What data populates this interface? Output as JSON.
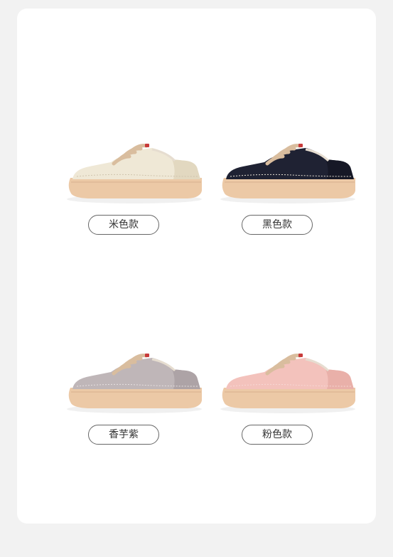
{
  "products": [
    {
      "label": "米色款",
      "upper": "#efe8d6",
      "upper_shade": "#e2d8c0",
      "sole": "#ecc9a6",
      "lace": "#d9bd9e",
      "stitch": "#cfc4ad"
    },
    {
      "label": "黑色款",
      "upper": "#1f2233",
      "upper_shade": "#161826",
      "sole": "#ecc9a6",
      "lace": "#d9bd9e",
      "stitch": "#e8e2d5"
    },
    {
      "label": "香芋紫",
      "upper": "#bfb6b8",
      "upper_shade": "#ada3a6",
      "sole": "#ecc9a6",
      "lace": "#d9bd9e",
      "stitch": "#e6e0e0"
    },
    {
      "label": "粉色款",
      "upper": "#f3c2bc",
      "upper_shade": "#e9b0a9",
      "sole": "#ecc9a6",
      "lace": "#d9bd9e",
      "stitch": "#f6d8d4"
    }
  ]
}
